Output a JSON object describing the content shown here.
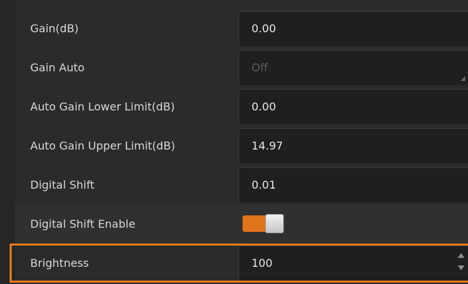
{
  "properties": [
    {
      "label": "Gain(dB)",
      "value": "0.00"
    },
    {
      "label": "Gain Auto",
      "value": "Off"
    },
    {
      "label": "Auto Gain Lower Limit(dB)",
      "value": "0.00"
    },
    {
      "label": "Auto Gain Upper Limit(dB)",
      "value": "14.97"
    },
    {
      "label": "Digital Shift",
      "value": "0.01"
    },
    {
      "label": "Digital Shift Enable",
      "toggle_on": true
    },
    {
      "label": "Brightness",
      "value": "100"
    }
  ],
  "colors": {
    "accent": "#ee7a1b",
    "toggle_on": "#e0741c",
    "background": "#2b2b2b",
    "input_background": "#1f1f1f"
  },
  "icons": {
    "combo": "dropdown-corner-icon",
    "spin_up": "spin-up-arrow-icon",
    "spin_down": "spin-down-arrow-icon"
  }
}
